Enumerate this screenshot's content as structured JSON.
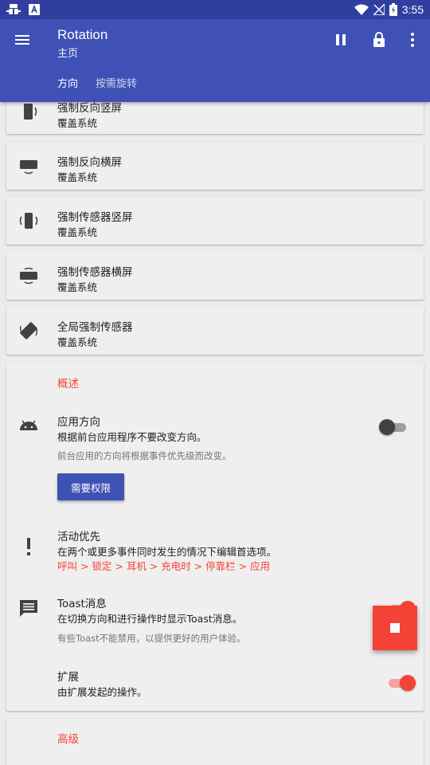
{
  "status_bar": {
    "time": "3:55",
    "left_icons": [
      "bug-notification-icon",
      "square-a-notification-icon"
    ],
    "right_icons": [
      "wifi-icon",
      "no-signal-icon",
      "battery-charging-icon"
    ]
  },
  "app_bar": {
    "title": "Rotation",
    "subtitle": "主页",
    "tabs": [
      {
        "label": "方向",
        "active": true
      },
      {
        "label": "按需旋转",
        "active": false
      }
    ],
    "actions": [
      "pause-icon",
      "lock-icon",
      "more-vert-icon"
    ]
  },
  "orientation_items": [
    {
      "title": "强制反向竖屏",
      "subtitle": "覆盖系统",
      "icon": "reverse-portrait-icon"
    },
    {
      "title": "强制反向横屏",
      "subtitle": "覆盖系统",
      "icon": "reverse-landscape-icon"
    },
    {
      "title": "强制传感器竖屏",
      "subtitle": "覆盖系统",
      "icon": "sensor-portrait-icon"
    },
    {
      "title": "强制传感器横屏",
      "subtitle": "覆盖系统",
      "icon": "sensor-landscape-icon"
    },
    {
      "title": "全局强制传感器",
      "subtitle": "覆盖系统",
      "icon": "full-sensor-icon"
    }
  ],
  "overview": {
    "section_title": "概述",
    "app_orientation": {
      "title": "应用方向",
      "desc": "根据前台应用程序不要改变方向。",
      "hint": "前台应用的方向将根据事件优先级而改变。",
      "button": "需要权限",
      "enabled": false
    },
    "event_priority": {
      "title": "活动优先",
      "desc": "在两个或更多事件同时发生的情况下编辑首选项。",
      "order": "呼叫 > 锁定 > 耳机 > 充电时 > 停靠栏 > 应用"
    },
    "toast": {
      "title": "Toast消息",
      "desc": "在切换方向和进行操作时显示Toast消息。",
      "hint": "有些Toast不能禁用，以提供更好的用户体验。",
      "enabled": true
    },
    "extension": {
      "title": "扩展",
      "desc": "由扩展发起的操作。",
      "enabled": true
    }
  },
  "advanced": {
    "section_title": "高级"
  },
  "fab": {
    "icon": "stop-icon"
  },
  "colors": {
    "primary": "#3f51b5",
    "primary_dark": "#303f9f",
    "accent": "#f44336"
  }
}
